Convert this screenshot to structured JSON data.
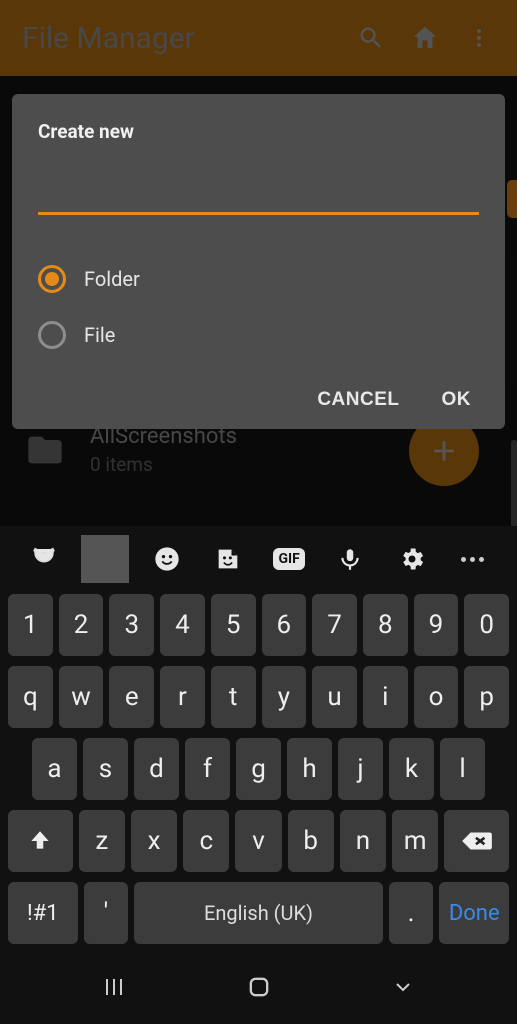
{
  "app": {
    "title": "File Manager",
    "folder": {
      "name": "AllScreenshots",
      "subtitle": "0 items"
    }
  },
  "dialog": {
    "title": "Create new",
    "input_value": "",
    "options": {
      "folder": "Folder",
      "file": "File"
    },
    "selected": "folder",
    "cancel": "CANCEL",
    "ok": "OK"
  },
  "keyboard": {
    "row1": [
      "1",
      "2",
      "3",
      "4",
      "5",
      "6",
      "7",
      "8",
      "9",
      "0"
    ],
    "row2": [
      "q",
      "w",
      "e",
      "r",
      "t",
      "y",
      "u",
      "i",
      "o",
      "p"
    ],
    "row3": [
      "a",
      "s",
      "d",
      "f",
      "g",
      "h",
      "j",
      "k",
      "l"
    ],
    "row4": [
      "z",
      "x",
      "c",
      "v",
      "b",
      "n",
      "m"
    ],
    "symKey": "!#1",
    "apostrophe": "'",
    "spaceLabel": "English (UK)",
    "period": ".",
    "done": "Done",
    "gif": "GIF"
  }
}
